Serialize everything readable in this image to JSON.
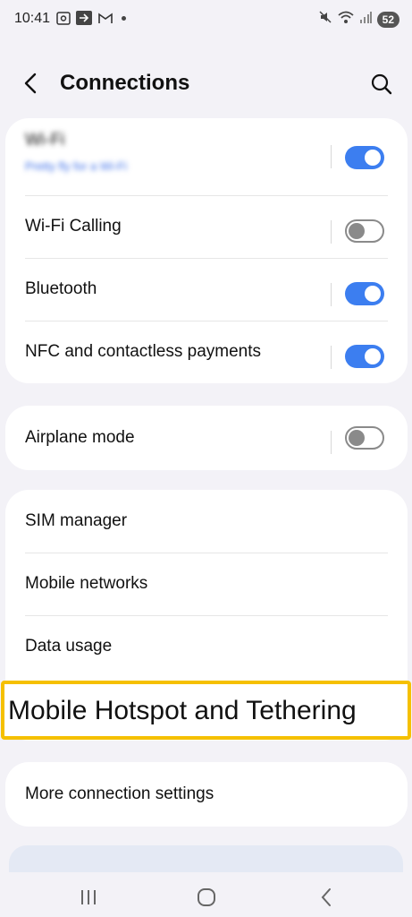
{
  "status_bar": {
    "time": "10:41",
    "battery": "52",
    "icons_left": [
      "screenshot-icon",
      "cast-icon",
      "gmail-icon",
      "dot-icon"
    ],
    "icons_right": [
      "mute-icon",
      "wifi-icon",
      "signal-icon",
      "battery-icon"
    ]
  },
  "header": {
    "title": "Connections"
  },
  "group1": {
    "wifi": {
      "label": "Wi-Fi",
      "sub": "Pretty fly for a Wi-Fi",
      "on": true
    },
    "wifi_calling": {
      "label": "Wi-Fi Calling",
      "on": false
    },
    "bluetooth": {
      "label": "Bluetooth",
      "on": true
    },
    "nfc": {
      "label": "NFC and contactless payments",
      "on": true
    }
  },
  "group2": {
    "airplane": {
      "label": "Airplane mode",
      "on": false
    }
  },
  "group3": {
    "sim_manager": "SIM manager",
    "mobile_networks": "Mobile networks",
    "data_usage": "Data usage",
    "hotspot": "Mobile Hotspot and Tethering"
  },
  "group4": {
    "more": "More connection settings"
  },
  "colors": {
    "accent": "#3c7ef0",
    "highlight": "#f5c000",
    "background": "#f3f2f7"
  }
}
